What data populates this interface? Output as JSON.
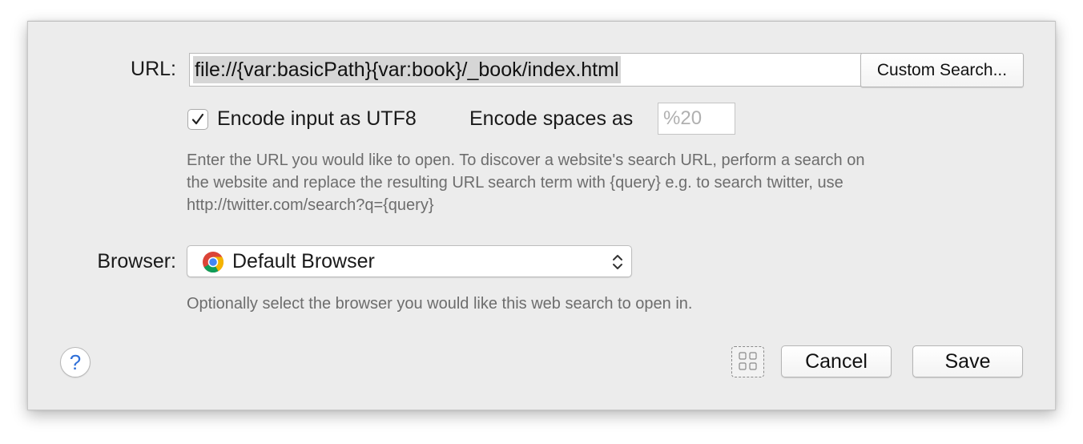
{
  "url": {
    "label": "URL:",
    "value": "file://{var:basicPath}{var:book}/_book/index.html",
    "custom_search_label": "Custom Search..."
  },
  "encoding": {
    "utf8_label": "Encode input as UTF8",
    "utf8_checked": true,
    "spaces_label": "Encode spaces as",
    "spaces_placeholder": "%20"
  },
  "url_help": {
    "line1": "Enter the URL you would like to open. To discover a website's search URL, perform a search on",
    "line2": "the website and replace the resulting URL search term with {query} e.g. to search twitter, use",
    "line3": "http://twitter.com/search?q={query}"
  },
  "browser": {
    "label": "Browser:",
    "selected": "Default Browser",
    "icon": "chrome-icon",
    "help": "Optionally select the browser you would like this web search to open in."
  },
  "footer": {
    "help_symbol": "?",
    "cancel_label": "Cancel",
    "save_label": "Save"
  },
  "colors": {
    "sheet_bg": "#ececec",
    "help_text": "#6d6d6d",
    "help_button": "#2f6fd8",
    "selection": "#d6d6d6"
  }
}
